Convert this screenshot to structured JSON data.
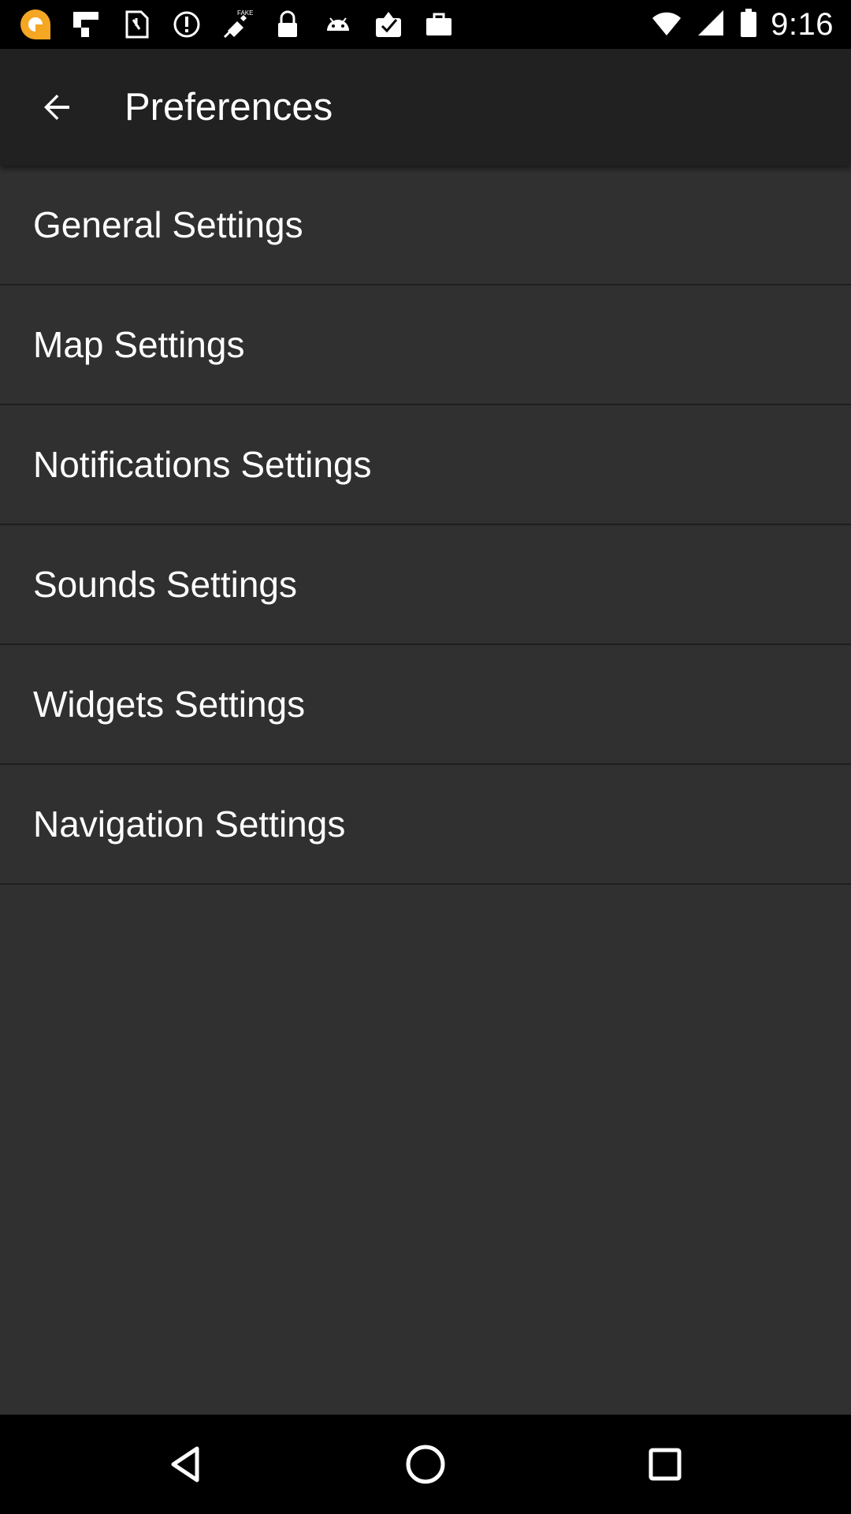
{
  "status_bar": {
    "time": "9:16",
    "icons": [
      "app-notification-icon",
      "flipboard-icon",
      "sim-card-icon",
      "alert-icon",
      "fake-gps-icon",
      "lock-icon",
      "android-icon",
      "clipboard-check-icon",
      "briefcase-icon"
    ]
  },
  "app_bar": {
    "title": "Preferences",
    "back_icon": "arrow-back-icon"
  },
  "settings": {
    "items": [
      {
        "label": "General Settings"
      },
      {
        "label": "Map Settings"
      },
      {
        "label": "Notifications Settings"
      },
      {
        "label": "Sounds Settings"
      },
      {
        "label": "Widgets Settings"
      },
      {
        "label": "Navigation Settings"
      }
    ]
  },
  "nav_bar": {
    "icons": [
      "back-triangle-icon",
      "home-circle-icon",
      "recents-square-icon"
    ]
  },
  "colors": {
    "background": "#303030",
    "app_bar": "#212121",
    "status_bar": "#000000",
    "accent": "#f5a623"
  }
}
